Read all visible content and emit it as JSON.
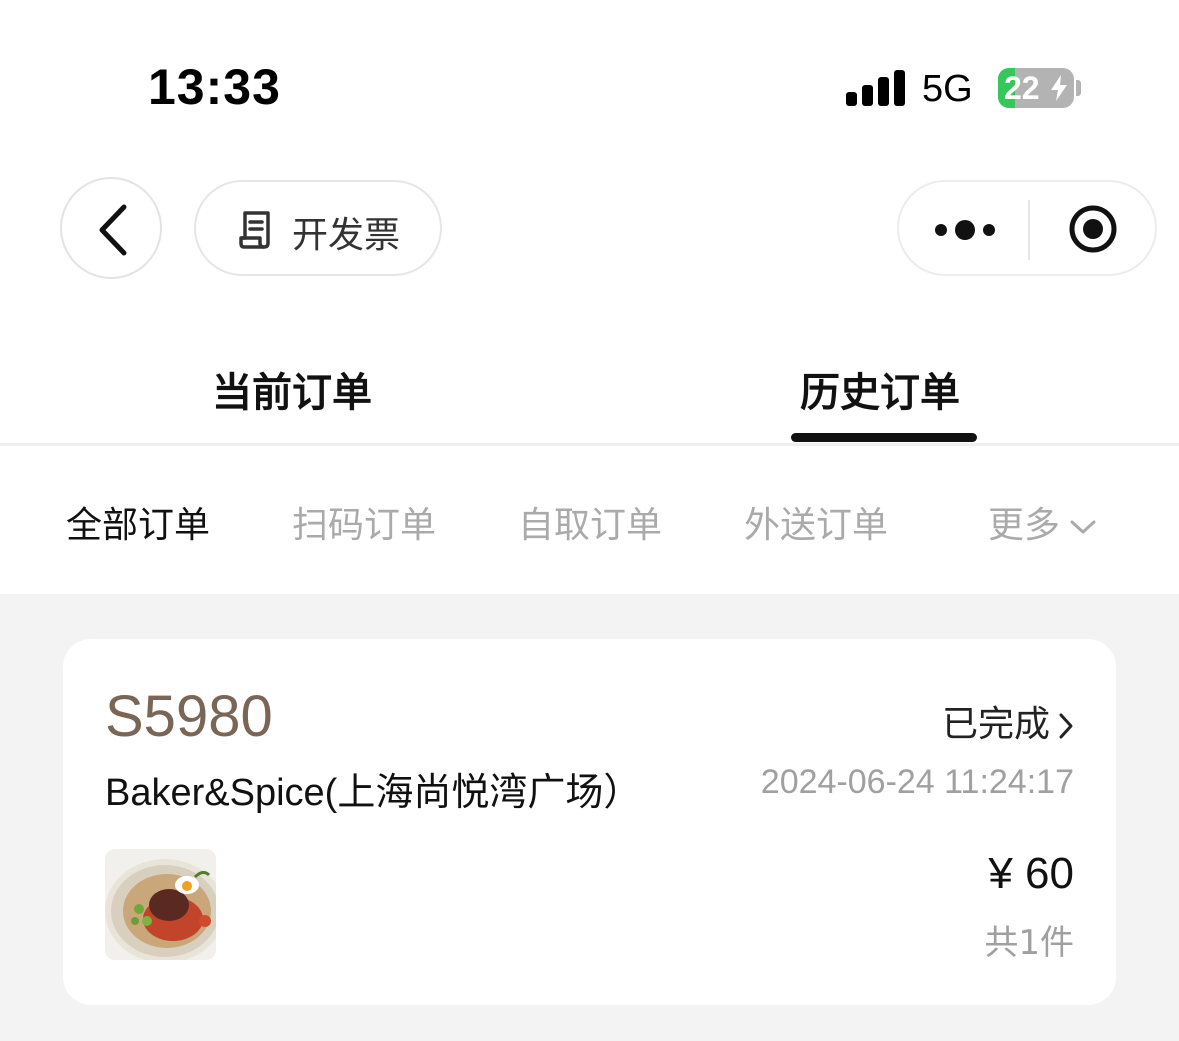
{
  "status_bar": {
    "time": "13:33",
    "network": "5G",
    "battery": "22",
    "battery_level": 0.22,
    "charging": true,
    "icons": [
      "signal-icon",
      "battery-icon",
      "charging-icon"
    ]
  },
  "nav": {
    "back_icon": "chevron-left-icon",
    "invoice_label": "开发票",
    "invoice_icon": "receipt-icon",
    "more_icon": "more-dots-icon",
    "close_icon": "close-miniprogram-icon"
  },
  "tabs": [
    {
      "label": "当前订单",
      "active": false
    },
    {
      "label": "历史订单",
      "active": true
    }
  ],
  "filters": [
    {
      "label": "全部订单",
      "active": true
    },
    {
      "label": "扫码订单",
      "active": false
    },
    {
      "label": "自取订单",
      "active": false
    },
    {
      "label": "外送订单",
      "active": false
    },
    {
      "label": "更多",
      "active": false,
      "icon": "chevron-down-icon"
    }
  ],
  "orders": [
    {
      "order_no": "S5980",
      "status": "已完成",
      "status_icon": "chevron-right-icon",
      "store": "Baker&Spice(上海尚悦湾广场）",
      "time": "2024-06-24 11:24:17",
      "price": "¥ 60",
      "count": "共1件",
      "thumbnail": "food-bowl-image"
    }
  ],
  "colors": {
    "accent_brown": "#7a6657",
    "inactive_gray": "#aaaaaa",
    "list_bg": "#f3f3f3",
    "battery_green": "#34c759"
  }
}
